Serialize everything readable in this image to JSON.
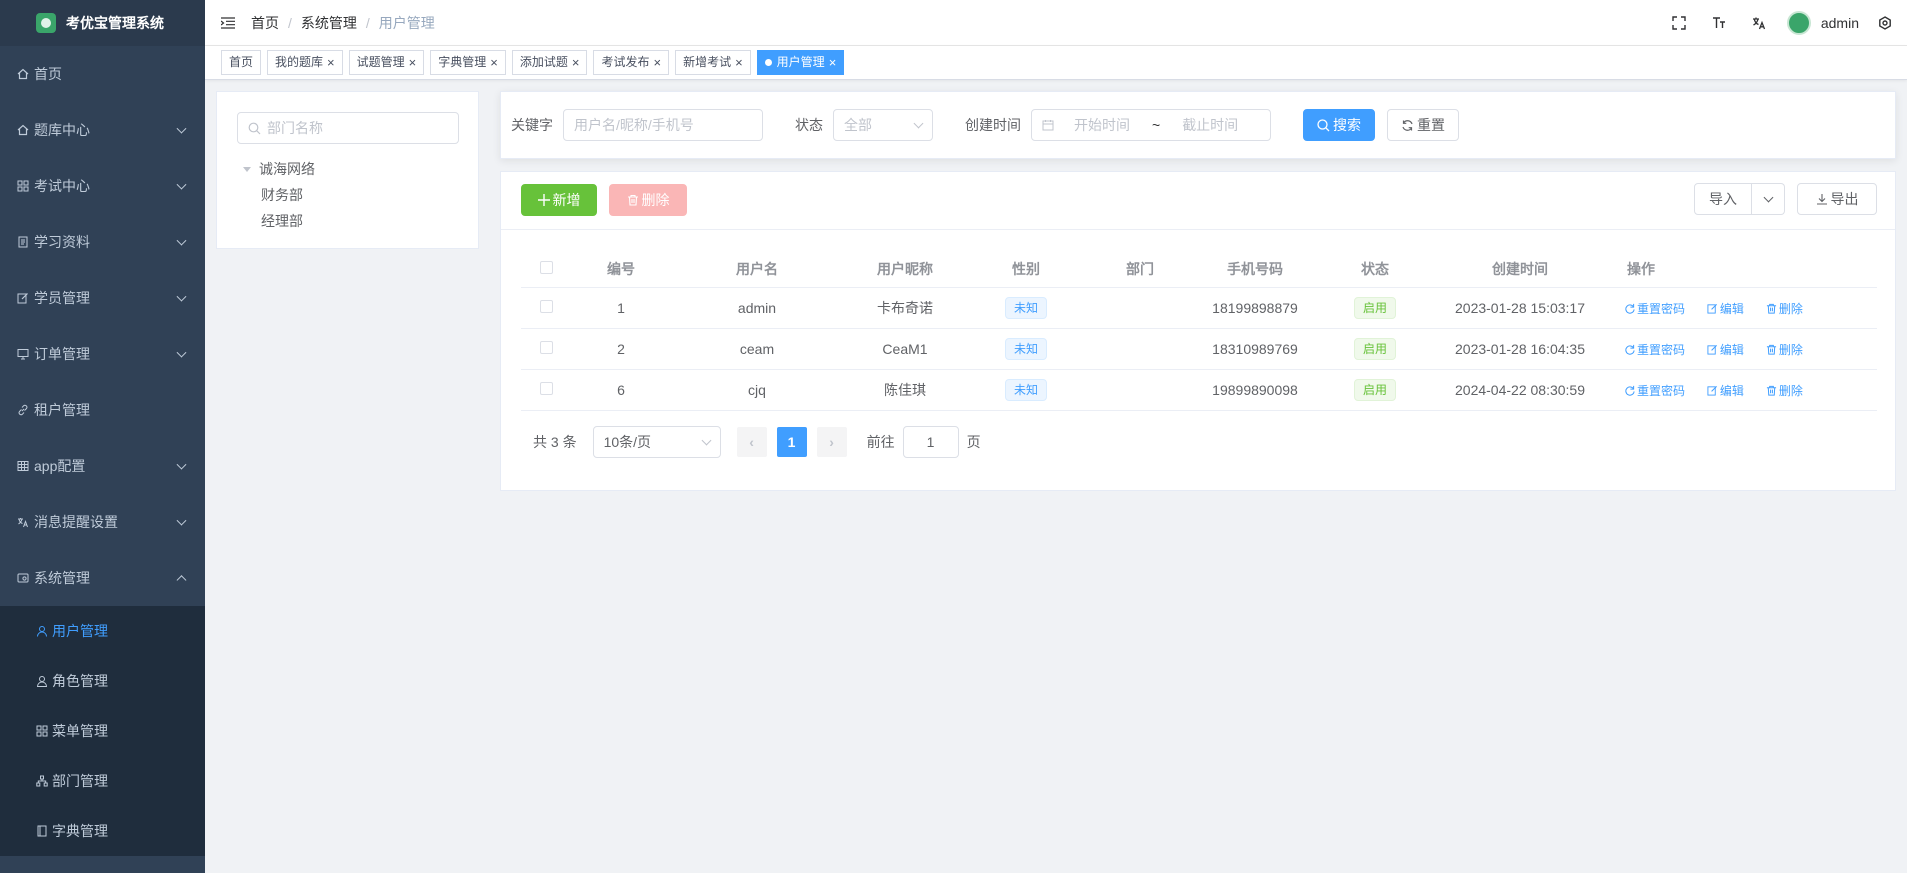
{
  "app": {
    "title": "考优宝管理系统"
  },
  "sidebar": {
    "items": [
      {
        "label": "首页",
        "icon": "home-icon",
        "expandable": false
      },
      {
        "label": "题库中心",
        "icon": "home-icon",
        "expandable": true
      },
      {
        "label": "考试中心",
        "icon": "grid-icon",
        "expandable": true
      },
      {
        "label": "学习资料",
        "icon": "document-icon",
        "expandable": true
      },
      {
        "label": "学员管理",
        "icon": "edit-icon",
        "expandable": true
      },
      {
        "label": "订单管理",
        "icon": "monitor-icon",
        "expandable": true
      },
      {
        "label": "租户管理",
        "icon": "link-icon",
        "expandable": false
      },
      {
        "label": "app配置",
        "icon": "table-icon",
        "expandable": true
      },
      {
        "label": "消息提醒设置",
        "icon": "translate-icon",
        "expandable": true
      },
      {
        "label": "系统管理",
        "icon": "system-icon",
        "expandable": true,
        "expanded": true
      }
    ],
    "sub_items": [
      {
        "label": "用户管理",
        "icon": "user-icon",
        "active": true
      },
      {
        "label": "角色管理",
        "icon": "people-icon",
        "active": false
      },
      {
        "label": "菜单管理",
        "icon": "tree-table-icon",
        "active": false
      },
      {
        "label": "部门管理",
        "icon": "tree-icon",
        "active": false
      },
      {
        "label": "字典管理",
        "icon": "dict-icon",
        "active": false
      }
    ]
  },
  "header": {
    "breadcrumb": [
      "首页",
      "系统管理",
      "用户管理"
    ],
    "username": "admin"
  },
  "tags": [
    {
      "label": "首页",
      "closable": false
    },
    {
      "label": "我的题库",
      "closable": true
    },
    {
      "label": "试题管理",
      "closable": true
    },
    {
      "label": "字典管理",
      "closable": true
    },
    {
      "label": "添加试题",
      "closable": true
    },
    {
      "label": "考试发布",
      "closable": true
    },
    {
      "label": "新增考试",
      "closable": true
    },
    {
      "label": "用户管理",
      "closable": true,
      "active": true
    }
  ],
  "dept_tree": {
    "search_placeholder": "部门名称",
    "root": "诚海网络",
    "children": [
      "财务部",
      "经理部"
    ]
  },
  "search": {
    "keyword_label": "关键字",
    "keyword_placeholder": "用户名/昵称/手机号",
    "status_label": "状态",
    "status_value": "全部",
    "created_label": "创建时间",
    "start_placeholder": "开始时间",
    "range_sep": "~",
    "end_placeholder": "截止时间",
    "search_btn": "搜索",
    "reset_btn": "重置"
  },
  "toolbar": {
    "add_btn": "新增",
    "delete_btn": "删除",
    "import_btn": "导入",
    "export_btn": "导出"
  },
  "table": {
    "columns": [
      "编号",
      "用户名",
      "用户昵称",
      "性别",
      "部门",
      "手机号码",
      "状态",
      "创建时间",
      "操作"
    ],
    "rows": [
      {
        "id": "1",
        "username": "admin",
        "nickname": "卡布奇诺",
        "gender": "未知",
        "dept": "",
        "phone": "18199898879",
        "status": "启用",
        "created": "2023-01-28 15:03:17"
      },
      {
        "id": "2",
        "username": "ceam",
        "nickname": "CeaM1",
        "gender": "未知",
        "dept": "",
        "phone": "18310989769",
        "status": "启用",
        "created": "2023-01-28 16:04:35"
      },
      {
        "id": "6",
        "username": "cjq",
        "nickname": "陈佳琪",
        "gender": "未知",
        "dept": "",
        "phone": "19899890098",
        "status": "启用",
        "created": "2024-04-22 08:30:59"
      }
    ],
    "actions": {
      "reset_pwd": "重置密码",
      "edit": "编辑",
      "delete": "删除"
    }
  },
  "pagination": {
    "total_text": "共 3 条",
    "page_size": "10条/页",
    "current_page": "1",
    "goto_label": "前往",
    "goto_value": "1",
    "page_suffix": "页"
  },
  "colors": {
    "sidebar_bg": "#304156",
    "primary": "#409eff",
    "success": "#67c23a",
    "danger_disabled": "#fab6b6",
    "brand": "#3aa56a"
  }
}
